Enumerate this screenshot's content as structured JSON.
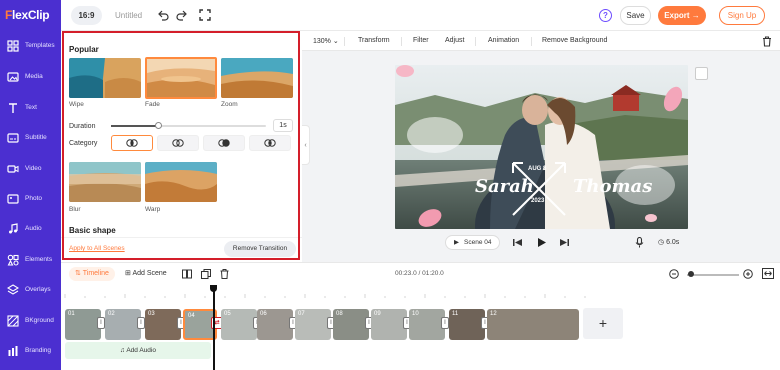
{
  "brand": {
    "name_left": "F",
    "name_right": "lexClip"
  },
  "topbar": {
    "ratio": "16:9",
    "title": "Untitled",
    "help": "?",
    "save": "Save",
    "export": "Export",
    "signup": "Sign Up"
  },
  "sidebar": {
    "items": [
      {
        "label": "Templates",
        "icon": "templates-icon"
      },
      {
        "label": "Media",
        "icon": "media-icon"
      },
      {
        "label": "Text",
        "icon": "text-icon"
      },
      {
        "label": "Subtitle",
        "icon": "subtitle-icon"
      },
      {
        "label": "Video",
        "icon": "video-icon"
      },
      {
        "label": "Photo",
        "icon": "photo-icon"
      },
      {
        "label": "Audio",
        "icon": "audio-icon"
      },
      {
        "label": "Elements",
        "icon": "elements-icon"
      },
      {
        "label": "Overlays",
        "icon": "overlays-icon"
      },
      {
        "label": "BKground",
        "icon": "background-icon"
      },
      {
        "label": "Branding",
        "icon": "branding-icon"
      }
    ]
  },
  "panel": {
    "popular_title": "Popular",
    "transitions": [
      {
        "label": "Wipe"
      },
      {
        "label": "Fade",
        "selected": true
      },
      {
        "label": "Zoom"
      }
    ],
    "duration_label": "Duration",
    "duration_value": "1s",
    "duration_fraction": 0.3,
    "category_label": "Category",
    "more_transitions": [
      {
        "label": "Blur"
      },
      {
        "label": "Warp"
      }
    ],
    "basic_shape_title": "Basic shape",
    "apply_all": "Apply to All Scenes",
    "remove": "Remove Transition"
  },
  "toolbar": {
    "zoom": "130%",
    "transform": "Transform",
    "filter": "Filter",
    "adjust": "Adjust",
    "animation": "Animation",
    "remove_bg": "Remove Background"
  },
  "canvas": {
    "name_left": "Sarah",
    "name_right": "Thomas",
    "date_top": "AUG 8",
    "year": "2023"
  },
  "playback": {
    "scene": "Scene 04",
    "duration": "6.0s"
  },
  "timeline": {
    "tab": "Timeline",
    "add_scene": "Add Scene",
    "time": "00:23.0 / 01:20.0",
    "add_audio": "Add Audio",
    "add_clip": "+",
    "clips": [
      "01",
      "02",
      "03",
      "04",
      "05",
      "06",
      "07",
      "08",
      "09",
      "10",
      "11",
      "12"
    ]
  },
  "colors": {
    "accent": "#ff7a3d",
    "nav": "#4b2fd0",
    "highlight": "#d41e2a"
  }
}
